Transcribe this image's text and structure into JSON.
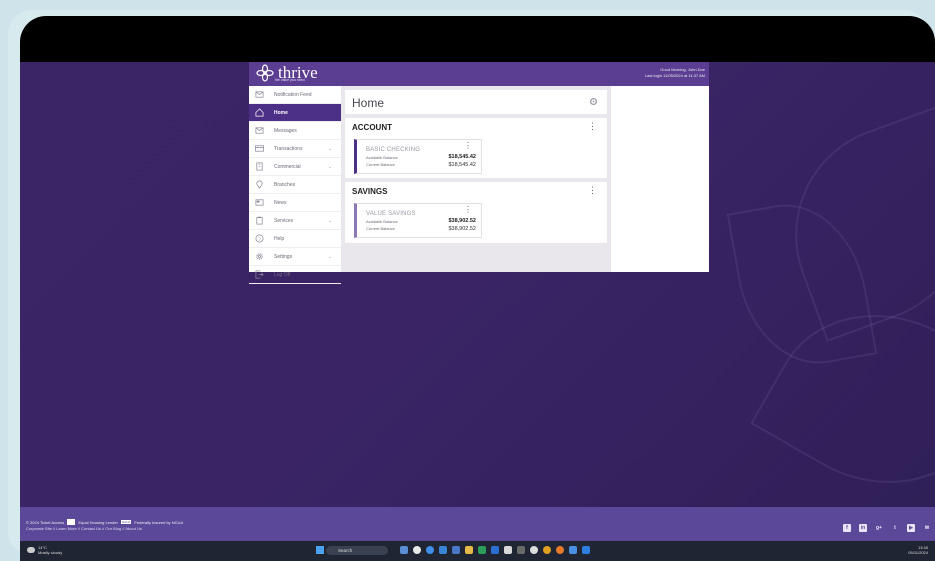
{
  "header": {
    "logo_text": "thrive",
    "logo_tagline": "the value you need",
    "greeting": "Good Morning, John Doe",
    "last_login": "Last login 11/05/2024 at 11:37 AM"
  },
  "sidebar": {
    "items": [
      {
        "label": "Notification Feed",
        "icon": "mail-icon"
      },
      {
        "label": "Home",
        "icon": "home-icon"
      },
      {
        "label": "Messages",
        "icon": "envelope-icon"
      },
      {
        "label": "Transactions",
        "icon": "card-icon",
        "chevron": true
      },
      {
        "label": "Commercial",
        "icon": "building-icon",
        "chevron": true
      },
      {
        "label": "Branches",
        "icon": "location-pin-icon"
      },
      {
        "label": "News",
        "icon": "newspaper-icon"
      },
      {
        "label": "Services",
        "icon": "clipboard-icon",
        "chevron": true
      },
      {
        "label": "Help",
        "icon": "question-icon"
      },
      {
        "label": "Settings",
        "icon": "gear-icon",
        "chevron": true
      },
      {
        "label": "Log Off",
        "icon": "logout-icon"
      }
    ],
    "active_index": 1
  },
  "main": {
    "page_title": "Home",
    "sections": [
      {
        "title": "ACCOUNT",
        "account": {
          "name": "BASIC CHECKING",
          "available_label": "Available Balance",
          "available_value": "$18,545.42",
          "current_label": "Current Balance",
          "current_value": "$18,545.42"
        }
      },
      {
        "title": "SAVINGS",
        "account": {
          "name": "VALUE SAVINGS",
          "available_label": "Available Balance",
          "available_value": "$38,902.52",
          "current_label": "Current Balance",
          "current_value": "$38,902.52"
        }
      }
    ]
  },
  "footer": {
    "copyright": "© 2024 Ticket Access",
    "equal_housing": "Equal Housing Lender",
    "ncua_badge": "NCUA",
    "insured": "Federally Insured by NCUA",
    "links": "Corporate Site // Learn More // Contact Us // Our Blog // About Us",
    "socials": [
      "facebook-icon",
      "linkedin-icon",
      "google-plus-icon",
      "twitter-icon",
      "youtube-icon",
      "email-icon"
    ]
  },
  "taskbar": {
    "weather_temp": "14°C",
    "weather_desc": "Mostly cloudy",
    "search_placeholder": "Search",
    "time": "13:45",
    "date": "05/11/2024"
  },
  "colors": {
    "brand_purple": "#5b3d92",
    "active_nav": "#4c2f86",
    "desktop_bg": "#3a2466"
  }
}
